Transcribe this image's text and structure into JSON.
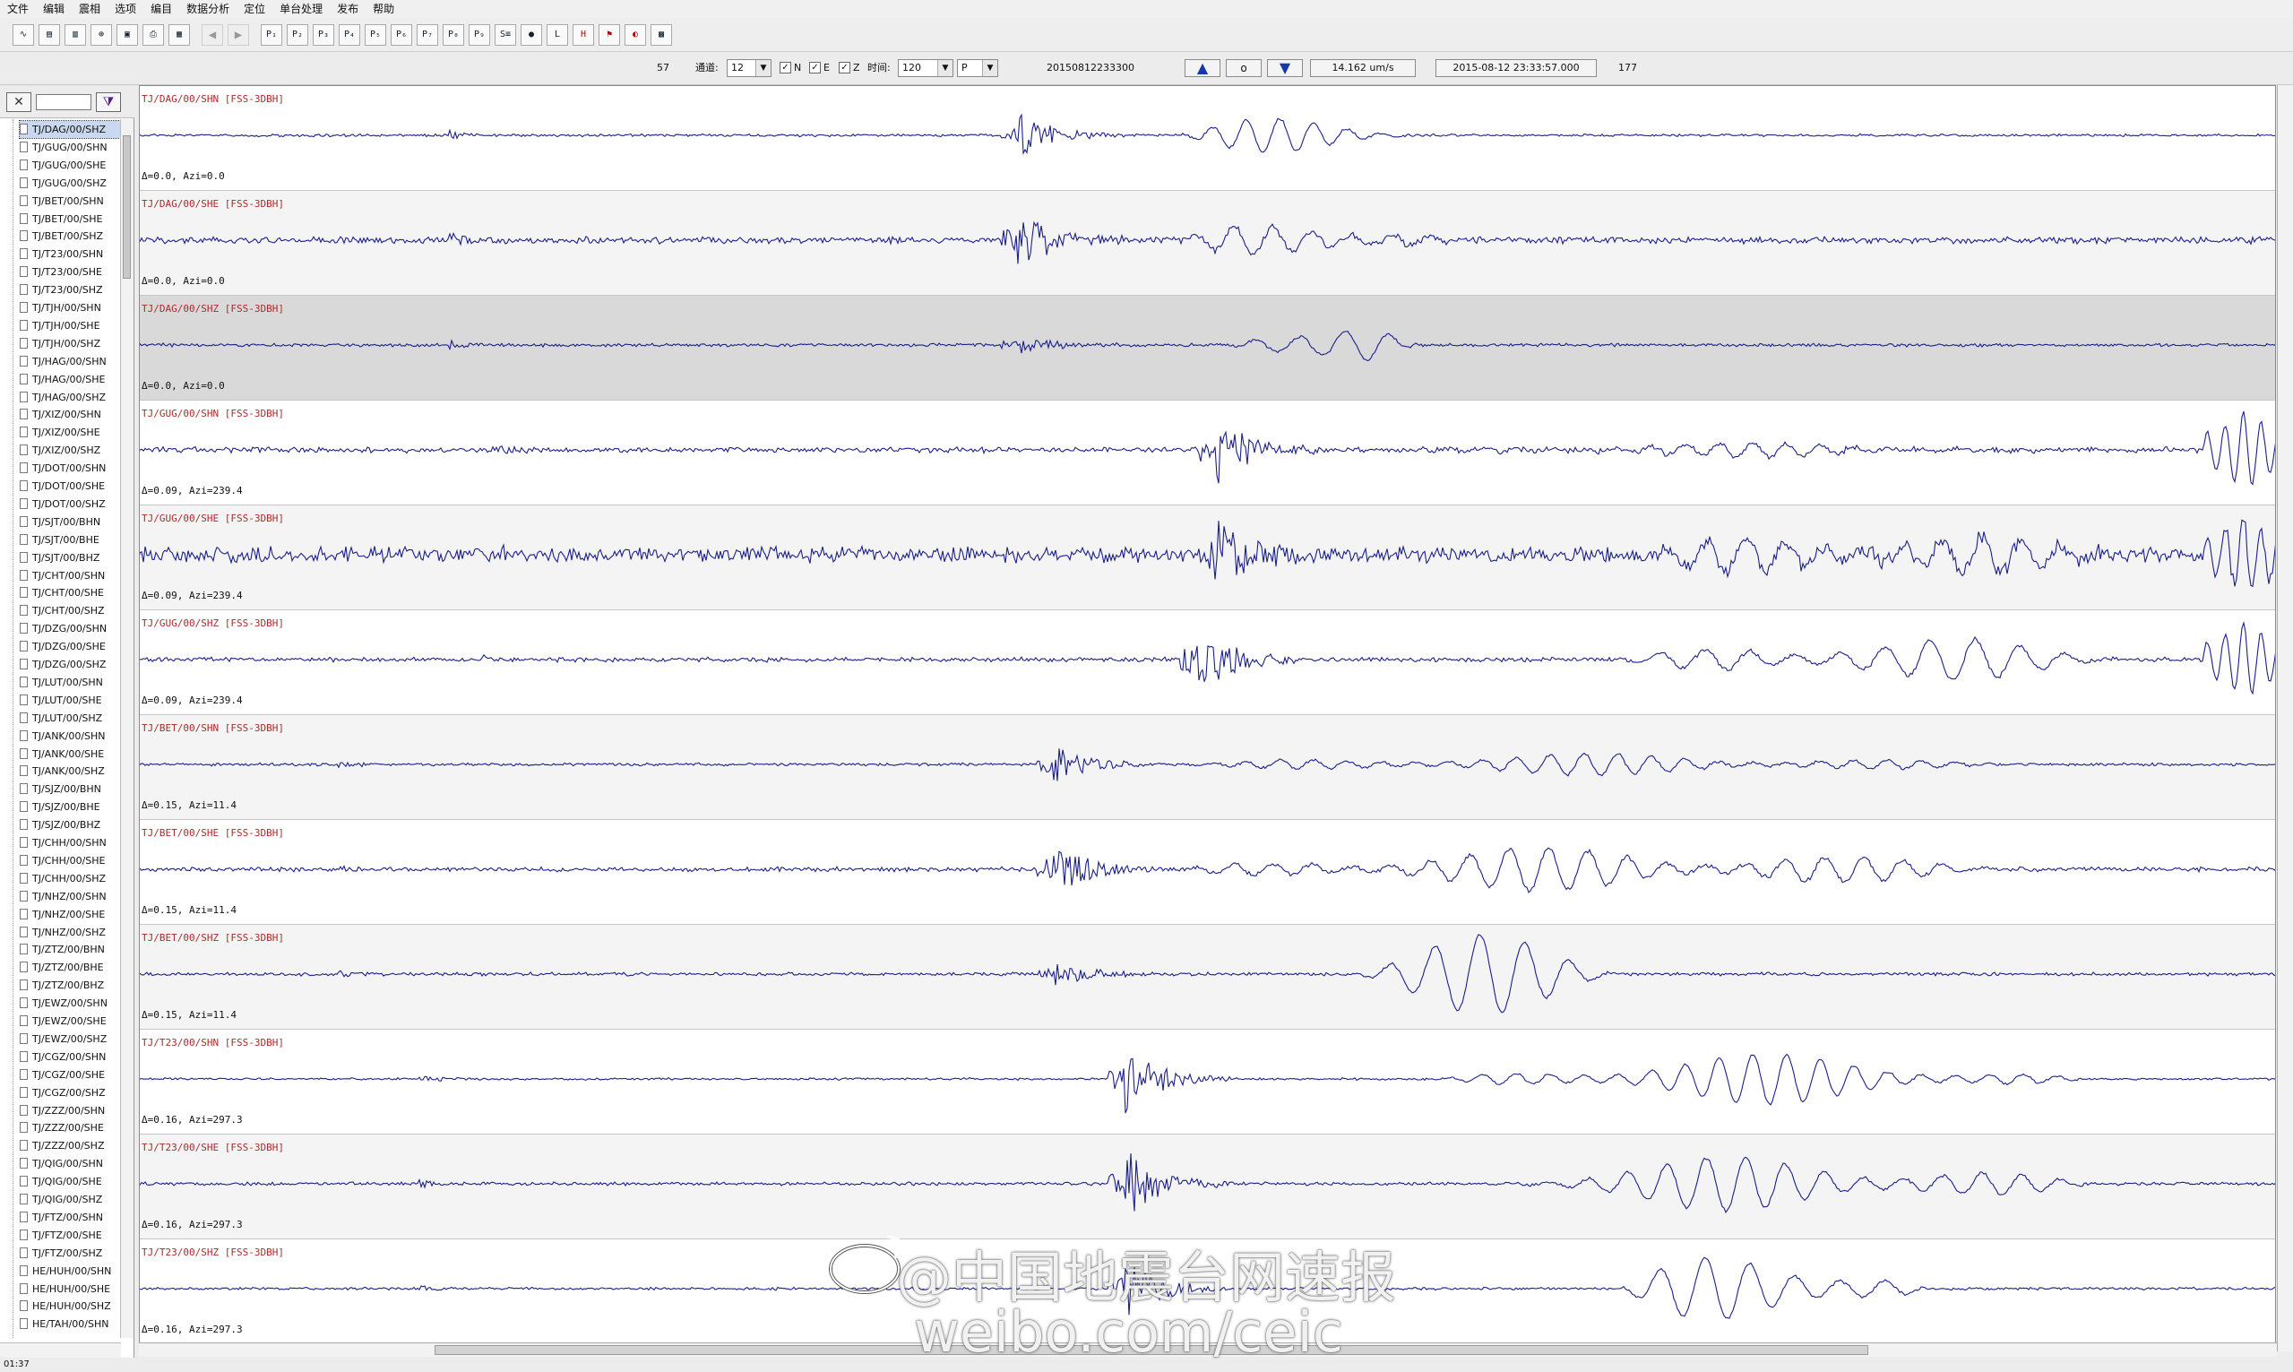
{
  "menu": [
    "文件",
    "编辑",
    "震相",
    "选项",
    "编目",
    "数据分析",
    "定位",
    "单台处理",
    "发布",
    "帮助"
  ],
  "toolbar_icons": [
    "wave-icon",
    "save-icon",
    "filter-icon",
    "pick-icon",
    "open-icon",
    "print-icon",
    "export-icon",
    "prev-icon",
    "next-icon",
    "P1",
    "P2",
    "P3",
    "P4",
    "P5",
    "P6",
    "P7",
    "P8",
    "P9",
    "P10",
    "P11",
    "P12",
    "P13",
    "P14",
    "P15",
    "P16"
  ],
  "controls": {
    "count": "57",
    "channel_label": "通道:",
    "channel_value": "12",
    "chk_n": "N",
    "chk_e": "E",
    "chk_z": "Z",
    "time_label": "时间:",
    "time_value": "120",
    "phase_value": "P",
    "event_id": "20150812233300",
    "up_label": "▲",
    "zero_label": "o",
    "down_label": "▼",
    "amplitude": "14.162 um/s",
    "datetime": "2015-08-12 23:33:57.000",
    "total": "177"
  },
  "tree": [
    "TJ/DAG/00/SHZ",
    "TJ/GUG/00/SHN",
    "TJ/GUG/00/SHE",
    "TJ/GUG/00/SHZ",
    "TJ/BET/00/SHN",
    "TJ/BET/00/SHE",
    "TJ/BET/00/SHZ",
    "TJ/T23/00/SHN",
    "TJ/T23/00/SHE",
    "TJ/T23/00/SHZ",
    "TJ/TJH/00/SHN",
    "TJ/TJH/00/SHE",
    "TJ/TJH/00/SHZ",
    "TJ/HAG/00/SHN",
    "TJ/HAG/00/SHE",
    "TJ/HAG/00/SHZ",
    "TJ/XIZ/00/SHN",
    "TJ/XIZ/00/SHE",
    "TJ/XIZ/00/SHZ",
    "TJ/DOT/00/SHN",
    "TJ/DOT/00/SHE",
    "TJ/DOT/00/SHZ",
    "TJ/SJT/00/BHN",
    "TJ/SJT/00/BHE",
    "TJ/SJT/00/BHZ",
    "TJ/CHT/00/SHN",
    "TJ/CHT/00/SHE",
    "TJ/CHT/00/SHZ",
    "TJ/DZG/00/SHN",
    "TJ/DZG/00/SHE",
    "TJ/DZG/00/SHZ",
    "TJ/LUT/00/SHN",
    "TJ/LUT/00/SHE",
    "TJ/LUT/00/SHZ",
    "TJ/ANK/00/SHN",
    "TJ/ANK/00/SHE",
    "TJ/ANK/00/SHZ",
    "TJ/SJZ/00/BHN",
    "TJ/SJZ/00/BHE",
    "TJ/SJZ/00/BHZ",
    "TJ/CHH/00/SHN",
    "TJ/CHH/00/SHE",
    "TJ/CHH/00/SHZ",
    "TJ/NHZ/00/SHN",
    "TJ/NHZ/00/SHE",
    "TJ/NHZ/00/SHZ",
    "TJ/ZTZ/00/BHN",
    "TJ/ZTZ/00/BHE",
    "TJ/ZTZ/00/BHZ",
    "TJ/EWZ/00/SHN",
    "TJ/EWZ/00/SHE",
    "TJ/EWZ/00/SHZ",
    "TJ/CGZ/00/SHN",
    "TJ/CGZ/00/SHE",
    "TJ/CGZ/00/SHZ",
    "TJ/ZZZ/00/SHN",
    "TJ/ZZZ/00/SHE",
    "TJ/ZZZ/00/SHZ",
    "TJ/QIG/00/SHN",
    "TJ/QIG/00/SHE",
    "TJ/QIG/00/SHZ",
    "TJ/FTZ/00/SHN",
    "TJ/FTZ/00/SHE",
    "TJ/FTZ/00/SHZ",
    "HE/HUH/00/SHN",
    "HE/HUH/00/SHE",
    "HE/HUH/00/SHZ",
    "HE/TAH/00/SHN"
  ],
  "traces": [
    {
      "label": "TJ/DAG/00/SHN [FSS-3DBH]",
      "info": "Δ=0.0, Azi=0.0",
      "style": "normal"
    },
    {
      "label": "TJ/DAG/00/SHE [FSS-3DBH]",
      "info": "Δ=0.0, Azi=0.0",
      "style": "alt"
    },
    {
      "label": "TJ/DAG/00/SHZ [FSS-3DBH]",
      "info": "Δ=0.0, Azi=0.0",
      "style": "selected"
    },
    {
      "label": "TJ/GUG/00/SHN [FSS-3DBH]",
      "info": "Δ=0.09, Azi=239.4",
      "style": "normal"
    },
    {
      "label": "TJ/GUG/00/SHE [FSS-3DBH]",
      "info": "Δ=0.09, Azi=239.4",
      "style": "alt"
    },
    {
      "label": "TJ/GUG/00/SHZ [FSS-3DBH]",
      "info": "Δ=0.09, Azi=239.4",
      "style": "normal"
    },
    {
      "label": "TJ/BET/00/SHN [FSS-3DBH]",
      "info": "Δ=0.15, Azi=11.4",
      "style": "alt"
    },
    {
      "label": "TJ/BET/00/SHE [FSS-3DBH]",
      "info": "Δ=0.15, Azi=11.4",
      "style": "normal"
    },
    {
      "label": "TJ/BET/00/SHZ [FSS-3DBH]",
      "info": "Δ=0.15, Azi=11.4",
      "style": "alt"
    },
    {
      "label": "TJ/T23/00/SHN [FSS-3DBH]",
      "info": "Δ=0.16, Azi=297.3",
      "style": "normal"
    },
    {
      "label": "TJ/T23/00/SHE [FSS-3DBH]",
      "info": "Δ=0.16, Azi=297.3",
      "style": "alt"
    },
    {
      "label": "TJ/T23/00/SHZ [FSS-3DBH]",
      "info": "Δ=0.16, Azi=297.3",
      "style": "normal"
    }
  ],
  "status_text": "01:37",
  "watermark": {
    "line1": "@中国地震台网速报",
    "line2": "weibo.com/ceic"
  },
  "colors": {
    "trace": "#1a1f8c",
    "label": "#b0292b",
    "accent_arrow": "#1538b0"
  }
}
